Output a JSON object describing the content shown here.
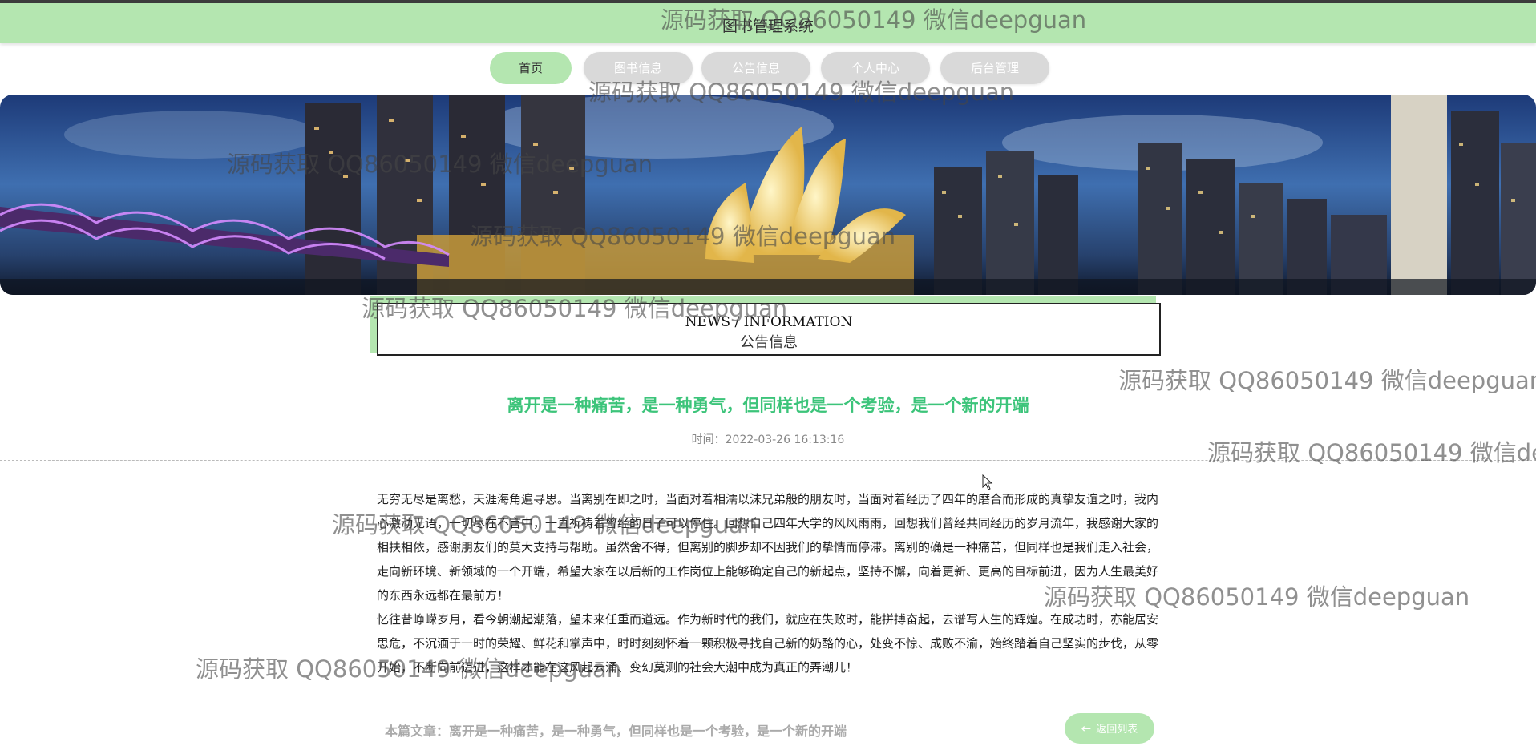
{
  "app": {
    "title": "图书管理系统"
  },
  "nav": {
    "items": [
      {
        "label": "首页",
        "active": true
      },
      {
        "label": "图书信息",
        "active": false
      },
      {
        "label": "公告信息",
        "active": false
      },
      {
        "label": "个人中心",
        "active": false
      },
      {
        "label": "后台管理",
        "active": false
      }
    ]
  },
  "section": {
    "title_en": "NEWS / INFORMATION",
    "title_cn": "公告信息"
  },
  "article": {
    "title": "离开是一种痛苦，是一种勇气，但同样也是一个考验，是一个新的开端",
    "time": "时间：2022-03-26 16:13:16",
    "paragraphs": [
      "无穷无尽是离愁，天涯海角遍寻思。当离别在即之时，当面对着相濡以沫兄弟般的朋友时，当面对着经历了四年的磨合而形成的真挚友谊之时，我内心激动无语，一切尽在不言中，一直祈祷着曾经的日子可以停住。回想自己四年大学的风风雨雨，回想我们曾经共同经历的岁月流年，我感谢大家的相扶相依，感谢朋友们的莫大支持与帮助。虽然舍不得，但离别的脚步却不因我们的挚情而停滞。离别的确是一种痛苦，但同样也是我们走入社会，走向新环境、新领域的一个开端，希望大家在以后新的工作岗位上能够确定自己的新起点，坚持不懈，向着更新、更高的目标前进，因为人生最美好的东西永远都在最前方！",
      "忆往昔峥嵘岁月，看今朝潮起潮落，望未来任重而道远。作为新时代的我们，就应在失败时，能拼搏奋起，去谱写人生的辉煌。在成功时，亦能居安思危，不沉湎于一时的荣耀、鲜花和掌声中，时时刻刻怀着一颗积极寻找自己新的奶酪的心，处变不惊、成败不渝，始终踏着自己坚实的步伐，从零开始，不断向前迈进，这样才能在这风起云涌、变幻莫测的社会大潮中成为真正的弄潮儿！"
    ],
    "footer_label": "本篇文章：",
    "footer_title": "离开是一种痛苦，是一种勇气，但同样也是一个考验，是一个新的开端",
    "back_label": "返回列表"
  },
  "watermark": {
    "text": "源码获取 QQ86050149 微信deepguan"
  },
  "colors": {
    "header_bg": "#b4e6b0",
    "accent_green": "#3cc47a",
    "inactive_nav": "#d9d9d9"
  }
}
